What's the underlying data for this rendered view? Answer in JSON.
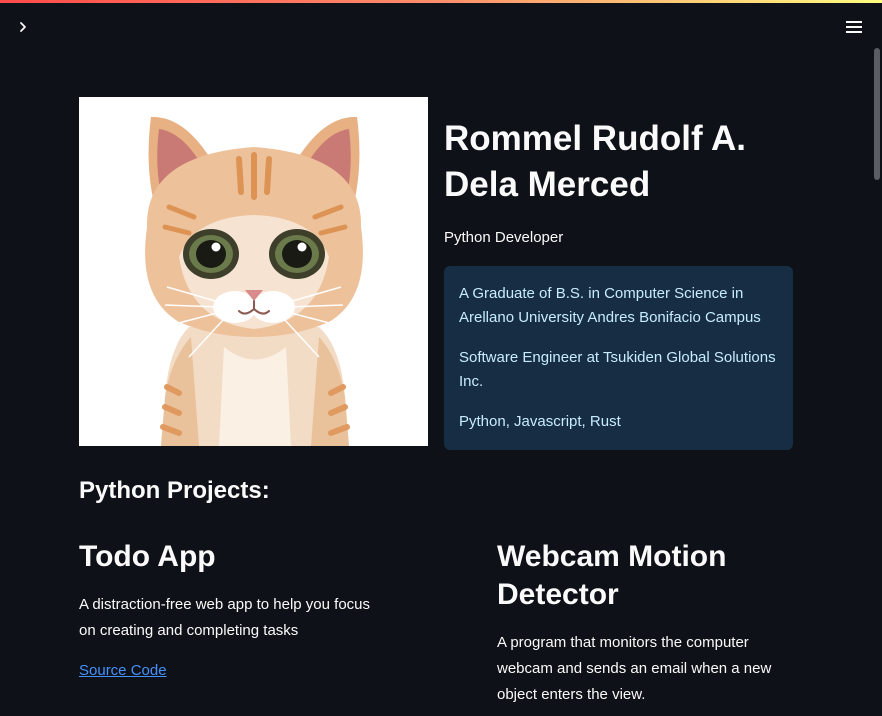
{
  "header": {
    "sidebar_toggle_icon": "chevron-right-icon",
    "menu_icon": "hamburger-menu-icon"
  },
  "profile": {
    "name": "Rommel Rudolf A. Dela Merced",
    "role": "Python Developer",
    "info": [
      "A Graduate of B.S. in Computer Science in Arellano University Andres Bonifacio Campus",
      "Software Engineer at Tsukiden Global Solutions Inc.",
      "Python, Javascript, Rust"
    ]
  },
  "projects_section": {
    "heading": "Python Projects:",
    "projects": [
      {
        "title": "Todo App",
        "description": "A distraction-free web app to help you focus on creating and completing tasks",
        "link_label": "Source Code"
      },
      {
        "title": "Webcam Motion Detector",
        "description": "A program that monitors the computer webcam and sends an email when a new object enters the view."
      }
    ]
  },
  "colors": {
    "background": "#0e1117",
    "info_box": "#172d43",
    "info_text": "#c7ebff",
    "link": "#4591ff"
  }
}
